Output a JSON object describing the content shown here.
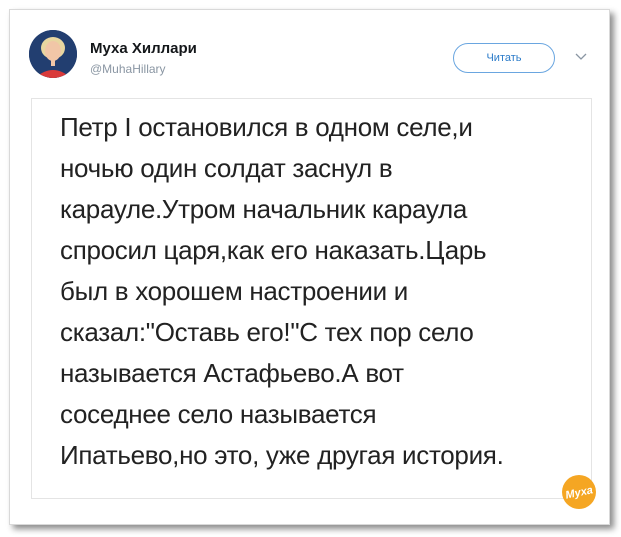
{
  "tweet": {
    "author_name": "Муха Хиллари",
    "author_handle": "@MuhaHillary",
    "follow_label": "Читать",
    "lines": [
      "Петр I остановился в одном селе,и",
      "ночью один солдат заснул в",
      "карауле.Утром начальник караула",
      "спросил царя,как его наказать.Царь",
      "был в хорошем настроении и",
      "сказал:\"Оставь его!\"С тех пор село",
      "называется Астафьево.А вот",
      "соседнее село называется",
      "Ипатьево,но это, уже другая история."
    ]
  },
  "watermark": {
    "text": "Муха"
  },
  "colors": {
    "accent": "#2b7bc9",
    "watermark": "#f5a623"
  },
  "icons": {
    "avatar": "profile-photo",
    "menu": "chevron-down-icon",
    "logo": "muha-logo"
  }
}
